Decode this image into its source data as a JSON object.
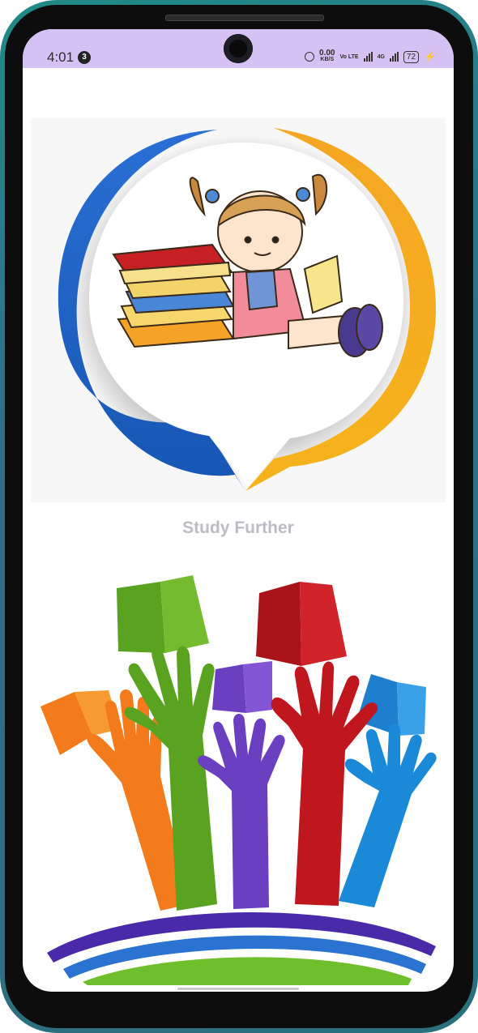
{
  "status_bar": {
    "time": "4:01",
    "notification_count": "3",
    "speed_value": "0.00",
    "speed_unit": "KB/S",
    "volte": "Vo LTE",
    "network": "4G",
    "battery": "72",
    "background_color": "#d6c1f5",
    "icons": [
      "alarm-icon",
      "signal-icon",
      "battery-icon",
      "charging-icon"
    ]
  },
  "app": {
    "title": "Study Further"
  },
  "colors": {
    "title_text": "#bcbcc4",
    "logo_blue": "#1f63c4",
    "logo_orange": "#f39a12",
    "hand_orange": "#f47b1c",
    "hand_green": "#5aa321",
    "hand_purple": "#6a3fc0",
    "hand_red": "#c0161d",
    "hand_blue": "#1a8ad8"
  }
}
